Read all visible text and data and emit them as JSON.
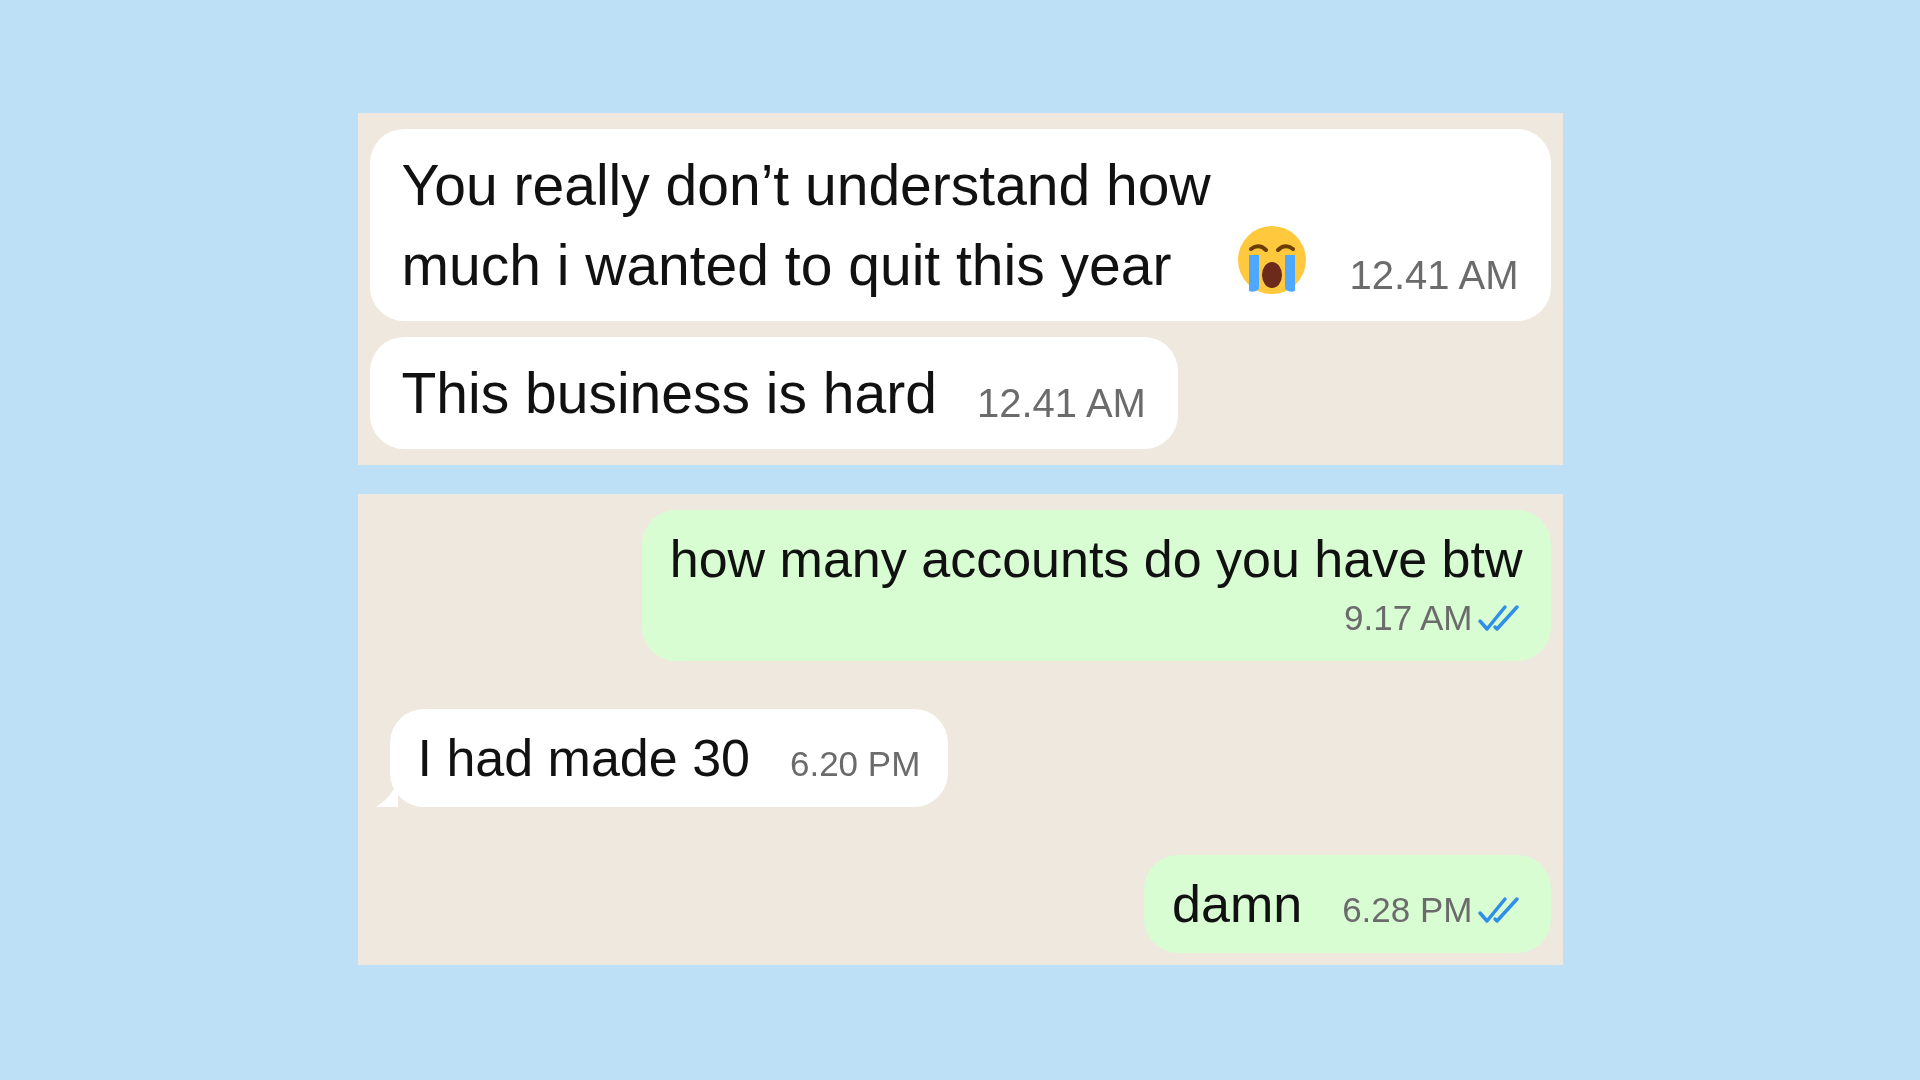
{
  "panels": [
    {
      "messages": [
        {
          "kind": "incoming",
          "text": "You really don’t understand how much i wanted to quit this year",
          "emoji": true,
          "time": "12.41 AM"
        },
        {
          "kind": "incoming",
          "text": "This business is hard",
          "time": "12.41 AM"
        }
      ]
    },
    {
      "messages": [
        {
          "kind": "outgoing",
          "text": "how many accounts do you have btw",
          "time": "9.17 AM",
          "read": true,
          "wrapped": true
        },
        {
          "kind": "incoming",
          "text": "I had made 30",
          "time": "6.20 PM",
          "tail": true
        },
        {
          "kind": "outgoing",
          "text": "damn",
          "time": "6.28 PM",
          "read": true
        }
      ]
    }
  ]
}
